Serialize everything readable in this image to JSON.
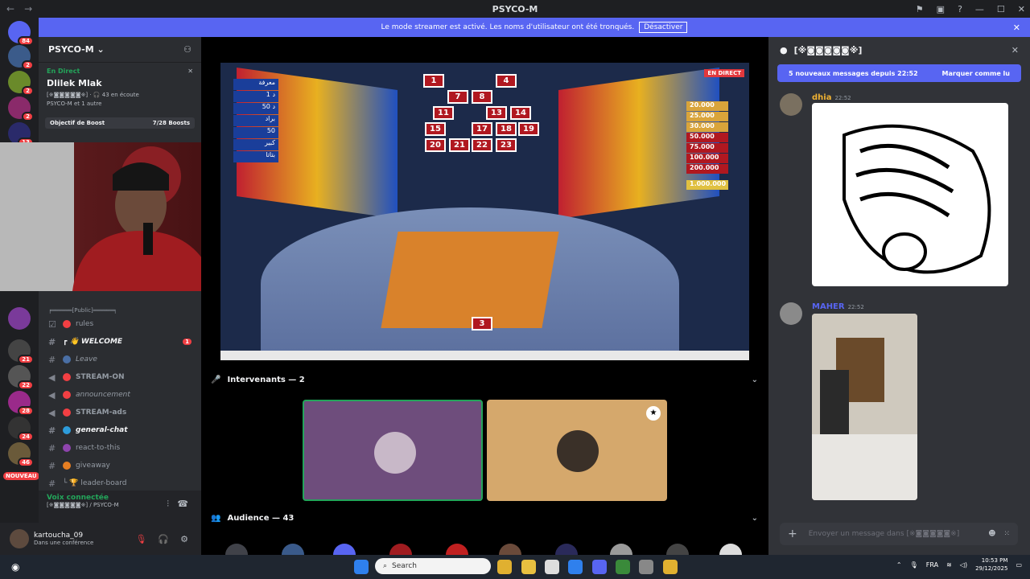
{
  "window": {
    "title": "PSYCO-M",
    "nav_back": "←",
    "nav_fwd": "→"
  },
  "banner": {
    "text": "Le mode streamer est activé. Les noms d'utilisateur ont été tronqués.",
    "button": "Désactiver"
  },
  "guild_badges": [
    "84",
    "2",
    "2",
    "2",
    "13",
    "21",
    "22",
    "28",
    "24",
    "46"
  ],
  "guild_new": "NOUVEAU",
  "server": {
    "name": "PSYCO-M",
    "live_tag": "En Direct",
    "streamer": "Dlilek Mlak",
    "listeners_line": "[※◙◙◙◙◙※] · 🎧 43 en écoute",
    "others_line": "PSYCO-M et 1 autre",
    "boost_label": "Objectif de Boost",
    "boost_value": "7/28 Boosts"
  },
  "category": "╒══════[Public]══════╕",
  "channels": [
    {
      "name": "rules",
      "prefix": "☑",
      "style": "normal",
      "color": "#f23f43"
    },
    {
      "name": "┏ 👋 WELCOME",
      "prefix": "#",
      "style": "unread",
      "badge": "1",
      "color": ""
    },
    {
      "name": "Leave",
      "prefix": "#",
      "style": "italic",
      "color": "#4a6fa5"
    },
    {
      "name": "STREAM-ON",
      "prefix": "📢",
      "style": "caps",
      "color": "#f23f43"
    },
    {
      "name": "announcement",
      "prefix": "📢",
      "style": "italic",
      "color": "#f23f43"
    },
    {
      "name": "STREAM-ads",
      "prefix": "📢",
      "style": "caps",
      "color": "#f23f43"
    },
    {
      "name": "general-chat",
      "prefix": "#",
      "style": "unread-italic",
      "color": "#2d9cdb"
    },
    {
      "name": "react-to-this",
      "prefix": "#",
      "style": "normal",
      "color": "#8e44ad"
    },
    {
      "name": "giveaway",
      "prefix": "#",
      "style": "normal",
      "color": "#e67e22"
    },
    {
      "name": "└ 🏆 leader-board",
      "prefix": "#",
      "style": "normal",
      "color": ""
    }
  ],
  "voice": {
    "status": "Voix connectée",
    "channel": "[※◙◙◙◙◙※] / PSYCO-M"
  },
  "user": {
    "name": "kartoucha_09",
    "status": "Dans une conférence"
  },
  "stage": {
    "live_badge": "EN DIRECT",
    "boxes": [
      "1",
      "4",
      "7",
      "8",
      "11",
      "13",
      "14",
      "15",
      "17",
      "18",
      "19",
      "20",
      "21",
      "22",
      "23"
    ],
    "bottom_box": "3",
    "prices": [
      "20.000",
      "25.000",
      "30.000",
      "50.000",
      "75.000",
      "100.000",
      "200.000",
      "1.000.000"
    ],
    "left_labels": [
      "معرفة",
      "1 د",
      "50 د",
      "براد",
      "50",
      "كبير",
      "بتاتا"
    ],
    "speakers_title": "Intervenants — 2",
    "audience_title": "Audience — 43"
  },
  "chat": {
    "title": "[※◙◙◙◙◙※]",
    "new_messages": "5 nouveaux messages depuis 22:52",
    "mark_read": "Marquer comme lu",
    "messages": [
      {
        "author": "dhia",
        "time": "22:52",
        "color": "#f0b232"
      },
      {
        "author": "MAHER",
        "time": "22:52",
        "color": "#5865f2"
      }
    ],
    "input_placeholder": "Envoyer un message dans [※◙◙◙◙◙※]"
  },
  "taskbar": {
    "search": "Search",
    "lang": "FRA",
    "time": "10:53 PM",
    "date": "29/12/2025"
  },
  "colors": {
    "accent": "#5865f2",
    "live": "#23a55a",
    "danger": "#f23f43",
    "tile1": "#6e4d7c",
    "tile2": "#d5a86c"
  }
}
